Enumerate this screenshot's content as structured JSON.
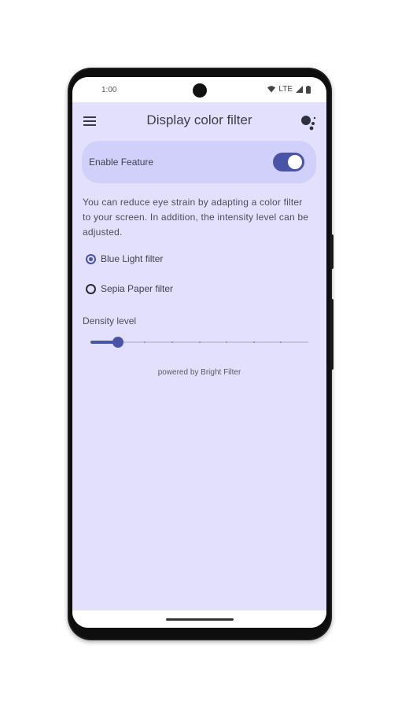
{
  "status_bar": {
    "time": "1:00",
    "network": "LTE",
    "wifi_icon": "wifi-icon",
    "signal_icon": "signal-icon",
    "battery_icon": "battery-icon"
  },
  "toolbar": {
    "title": "Display color filter",
    "menu_icon": "menu-icon",
    "assistant_icon": "assistant-icon"
  },
  "enable_feature": {
    "label": "Enable Feature",
    "enabled": true
  },
  "description": "You can reduce eye strain by adapting a color filter to your screen. In addition, the intensity level can be adjusted.",
  "filters": [
    {
      "label": "Blue Light filter",
      "selected": true
    },
    {
      "label": "Sepia Paper filter",
      "selected": false
    }
  ],
  "density": {
    "label": "Density level",
    "value": 1,
    "max": 8
  },
  "footer": "powered by Bright Filter",
  "colors": {
    "accent": "#4a54a6",
    "background": "#e2e0fd",
    "card": "#d0d0fb"
  }
}
